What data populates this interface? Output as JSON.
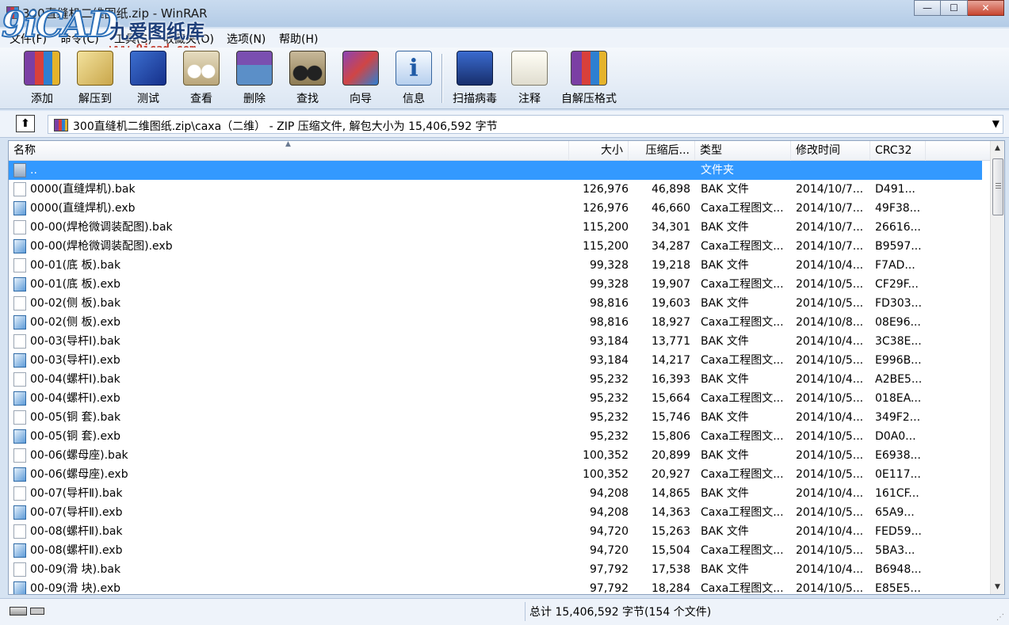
{
  "window": {
    "title": "300直缝机二维图纸.zip - WinRAR",
    "controls": {
      "minimize": "—",
      "maximize": "☐",
      "close": "✕"
    }
  },
  "watermark": {
    "logo": "9iCAD",
    "name": "九爱图纸库",
    "url": "www.9icad.com"
  },
  "menu": [
    {
      "label": "文件(F)"
    },
    {
      "label": "命令(C)"
    },
    {
      "label": "工具(S)"
    },
    {
      "label": "收藏夹(O)"
    },
    {
      "label": "选项(N)"
    },
    {
      "label": "帮助(H)"
    }
  ],
  "toolbar": [
    {
      "label": "添加",
      "icon": "add-icon"
    },
    {
      "label": "解压到",
      "icon": "extract-icon"
    },
    {
      "label": "测试",
      "icon": "test-icon"
    },
    {
      "label": "查看",
      "icon": "view-icon"
    },
    {
      "label": "删除",
      "icon": "delete-icon"
    },
    {
      "label": "查找",
      "icon": "find-icon"
    },
    {
      "label": "向导",
      "icon": "wizard-icon"
    },
    {
      "label": "信息",
      "icon": "info-icon"
    },
    {
      "label": "扫描病毒",
      "icon": "scan-virus-icon"
    },
    {
      "label": "注释",
      "icon": "comment-icon"
    },
    {
      "label": "自解压格式",
      "icon": "sfx-icon"
    }
  ],
  "address": {
    "up_glyph": "⬆",
    "path": "300直缝机二维图纸.zip\\caxa（二维） - ZIP 压缩文件, 解包大小为 15,406,592 字节",
    "dropdown_glyph": "▼"
  },
  "columns": {
    "name": "名称",
    "size": "大小",
    "packed": "压缩后...",
    "type": "类型",
    "modified": "修改时间",
    "crc": "CRC32",
    "sort_indicator": "▲"
  },
  "files": [
    {
      "name": "..",
      "size": "",
      "packed": "",
      "type": "文件夹",
      "modified": "",
      "crc": "",
      "icon": "folder-icon",
      "selected": true
    },
    {
      "name": "0000(直缝焊机).bak",
      "size": "126,976",
      "packed": "46,898",
      "type": "BAK 文件",
      "modified": "2014/10/7...",
      "crc": "D491...",
      "icon": "bak-file-icon"
    },
    {
      "name": "0000(直缝焊机).exb",
      "size": "126,976",
      "packed": "46,660",
      "type": "Caxa工程图文...",
      "modified": "2014/10/7...",
      "crc": "49F38...",
      "icon": "exb-file-icon"
    },
    {
      "name": "00-00(焊枪微调装配图).bak",
      "size": "115,200",
      "packed": "34,301",
      "type": "BAK 文件",
      "modified": "2014/10/7...",
      "crc": "26616...",
      "icon": "bak-file-icon"
    },
    {
      "name": "00-00(焊枪微调装配图).exb",
      "size": "115,200",
      "packed": "34,287",
      "type": "Caxa工程图文...",
      "modified": "2014/10/7...",
      "crc": "B9597...",
      "icon": "exb-file-icon"
    },
    {
      "name": "00-01(底  板).bak",
      "size": "99,328",
      "packed": "19,218",
      "type": "BAK 文件",
      "modified": "2014/10/4...",
      "crc": "F7AD...",
      "icon": "bak-file-icon"
    },
    {
      "name": "00-01(底  板).exb",
      "size": "99,328",
      "packed": "19,907",
      "type": "Caxa工程图文...",
      "modified": "2014/10/5...",
      "crc": "CF29F...",
      "icon": "exb-file-icon"
    },
    {
      "name": "00-02(侧  板).bak",
      "size": "98,816",
      "packed": "19,603",
      "type": "BAK 文件",
      "modified": "2014/10/5...",
      "crc": "FD303...",
      "icon": "bak-file-icon"
    },
    {
      "name": "00-02(侧  板).exb",
      "size": "98,816",
      "packed": "18,927",
      "type": "Caxa工程图文...",
      "modified": "2014/10/8...",
      "crc": "08E96...",
      "icon": "exb-file-icon"
    },
    {
      "name": "00-03(导杆Ⅰ).bak",
      "size": "93,184",
      "packed": "13,771",
      "type": "BAK 文件",
      "modified": "2014/10/4...",
      "crc": "3C38E...",
      "icon": "bak-file-icon"
    },
    {
      "name": "00-03(导杆Ⅰ).exb",
      "size": "93,184",
      "packed": "14,217",
      "type": "Caxa工程图文...",
      "modified": "2014/10/5...",
      "crc": "E996B...",
      "icon": "exb-file-icon"
    },
    {
      "name": "00-04(螺杆Ⅰ).bak",
      "size": "95,232",
      "packed": "16,393",
      "type": "BAK 文件",
      "modified": "2014/10/4...",
      "crc": "A2BE5...",
      "icon": "bak-file-icon"
    },
    {
      "name": "00-04(螺杆Ⅰ).exb",
      "size": "95,232",
      "packed": "15,664",
      "type": "Caxa工程图文...",
      "modified": "2014/10/5...",
      "crc": "018EA...",
      "icon": "exb-file-icon"
    },
    {
      "name": "00-05(铜  套).bak",
      "size": "95,232",
      "packed": "15,746",
      "type": "BAK 文件",
      "modified": "2014/10/4...",
      "crc": "349F2...",
      "icon": "bak-file-icon"
    },
    {
      "name": "00-05(铜  套).exb",
      "size": "95,232",
      "packed": "15,806",
      "type": "Caxa工程图文...",
      "modified": "2014/10/5...",
      "crc": "D0A0...",
      "icon": "exb-file-icon"
    },
    {
      "name": "00-06(螺母座).bak",
      "size": "100,352",
      "packed": "20,899",
      "type": "BAK 文件",
      "modified": "2014/10/5...",
      "crc": "E6938...",
      "icon": "bak-file-icon"
    },
    {
      "name": "00-06(螺母座).exb",
      "size": "100,352",
      "packed": "20,927",
      "type": "Caxa工程图文...",
      "modified": "2014/10/5...",
      "crc": "0E117...",
      "icon": "exb-file-icon"
    },
    {
      "name": "00-07(导杆Ⅱ).bak",
      "size": "94,208",
      "packed": "14,865",
      "type": "BAK 文件",
      "modified": "2014/10/4...",
      "crc": "161CF...",
      "icon": "bak-file-icon"
    },
    {
      "name": "00-07(导杆Ⅱ).exb",
      "size": "94,208",
      "packed": "14,363",
      "type": "Caxa工程图文...",
      "modified": "2014/10/5...",
      "crc": "65A9...",
      "icon": "exb-file-icon"
    },
    {
      "name": "00-08(螺杆Ⅱ).bak",
      "size": "94,720",
      "packed": "15,263",
      "type": "BAK 文件",
      "modified": "2014/10/4...",
      "crc": "FED59...",
      "icon": "bak-file-icon"
    },
    {
      "name": "00-08(螺杆Ⅱ).exb",
      "size": "94,720",
      "packed": "15,504",
      "type": "Caxa工程图文...",
      "modified": "2014/10/5...",
      "crc": "5BA3...",
      "icon": "exb-file-icon"
    },
    {
      "name": "00-09(滑  块).bak",
      "size": "97,792",
      "packed": "17,538",
      "type": "BAK 文件",
      "modified": "2014/10/4...",
      "crc": "B6948...",
      "icon": "bak-file-icon"
    },
    {
      "name": "00-09(滑  块).exb",
      "size": "97,792",
      "packed": "18,284",
      "type": "Caxa工程图文...",
      "modified": "2014/10/5...",
      "crc": "E85E5...",
      "icon": "exb-file-icon"
    }
  ],
  "scrollbar": {
    "up": "▲",
    "down": "▼"
  },
  "status": {
    "total": "总计 15,406,592 字节(154 个文件)"
  },
  "colors": {
    "selection": "#3399ff",
    "window_frame": "#b3cbe6"
  }
}
